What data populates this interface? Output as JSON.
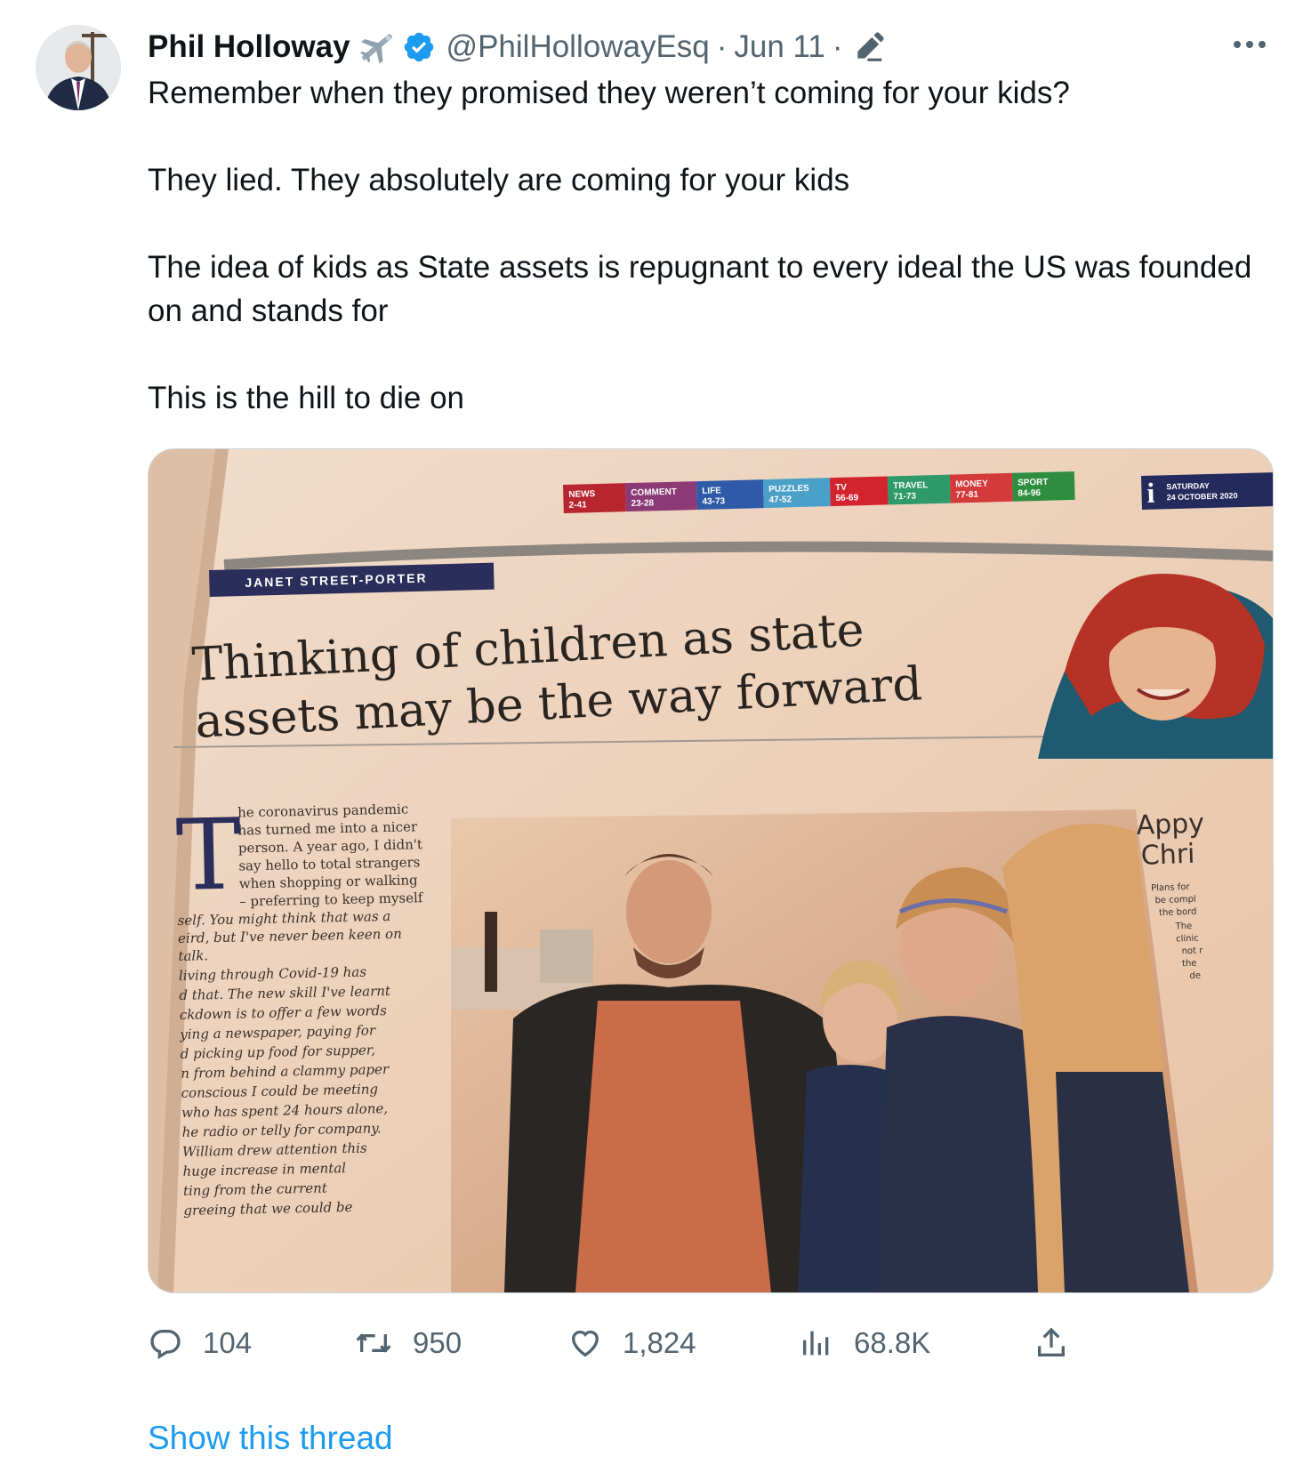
{
  "author": {
    "name": "Phil Holloway",
    "handle": "@PhilHollowayEsq",
    "separator": "·",
    "date": "Jun 11",
    "date_suffix": "·",
    "name_emoji": "airplane-icon",
    "badge": "verified-badge-icon"
  },
  "tweet": {
    "paragraphs": [
      "Remember when they promised they weren’t coming for your kids?",
      "They lied. They absolutely are coming for your kids",
      "The idea of kids as State assets is repugnant to every ideal the US was founded on and stands for",
      "This is the hill to die on"
    ]
  },
  "media": {
    "newspaper": {
      "nav_tabs": [
        {
          "label": "NEWS",
          "pages": "2-41",
          "color": "#b8252f"
        },
        {
          "label": "COMMENT",
          "pages": "23-28",
          "color": "#8b3a76"
        },
        {
          "label": "LIFE",
          "pages": "43-73",
          "color": "#2f5aa8"
        },
        {
          "label": "PUZZLES",
          "pages": "47-52",
          "color": "#4aa0c8"
        },
        {
          "label": "TV",
          "pages": "56-69",
          "color": "#d3242e"
        },
        {
          "label": "TRAVEL",
          "pages": "71-73",
          "color": "#2e9a6a"
        },
        {
          "label": "MONEY",
          "pages": "77-81",
          "color": "#d43a3a"
        },
        {
          "label": "SPORT",
          "pages": "84-96",
          "color": "#2f8d3f"
        }
      ],
      "date_day": "SATURDAY",
      "date_full": "24 OCTOBER 2020",
      "masthead_letter": "i",
      "columnist": "JANET STREET-PORTER",
      "headline_line1": "Thinking of children as state",
      "headline_line2": "assets may be the way forward",
      "drop_cap": "T",
      "body_lines": [
        "he coronavirus pandemic",
        "has turned me into a nicer",
        "person. A year ago, I didn't",
        "say hello to total strangers",
        "when shopping or walking",
        "– preferring to keep myself",
        "self. You might think that was a",
        "eird, but I've never been keen on",
        "talk.",
        "living through Covid-19 has",
        "d that. The new skill I've learnt",
        "ckdown is to offer a few words",
        "ying a newspaper, paying for",
        "d picking up food for supper,",
        "n from behind a clammy paper",
        "conscious I could be meeting",
        "who has spent 24 hours alone,",
        "he radio or telly for company.",
        "William drew attention this",
        "huge increase in mental",
        "ting from the current",
        "greeing that we could be"
      ],
      "sidebar_title_1": "Appy",
      "sidebar_title_2": "Chri",
      "sidebar_lines": [
        "Plans for",
        "be compl",
        "the bord",
        "The",
        "clinic",
        "not r",
        "the",
        "de"
      ]
    }
  },
  "actions": {
    "replies": "104",
    "reposts": "950",
    "likes": "1,824",
    "views": "68.8K"
  },
  "thread_link": "Show this thread",
  "colors": {
    "accent": "#1d9bf0",
    "muted": "#536471",
    "text": "#0f1419"
  }
}
